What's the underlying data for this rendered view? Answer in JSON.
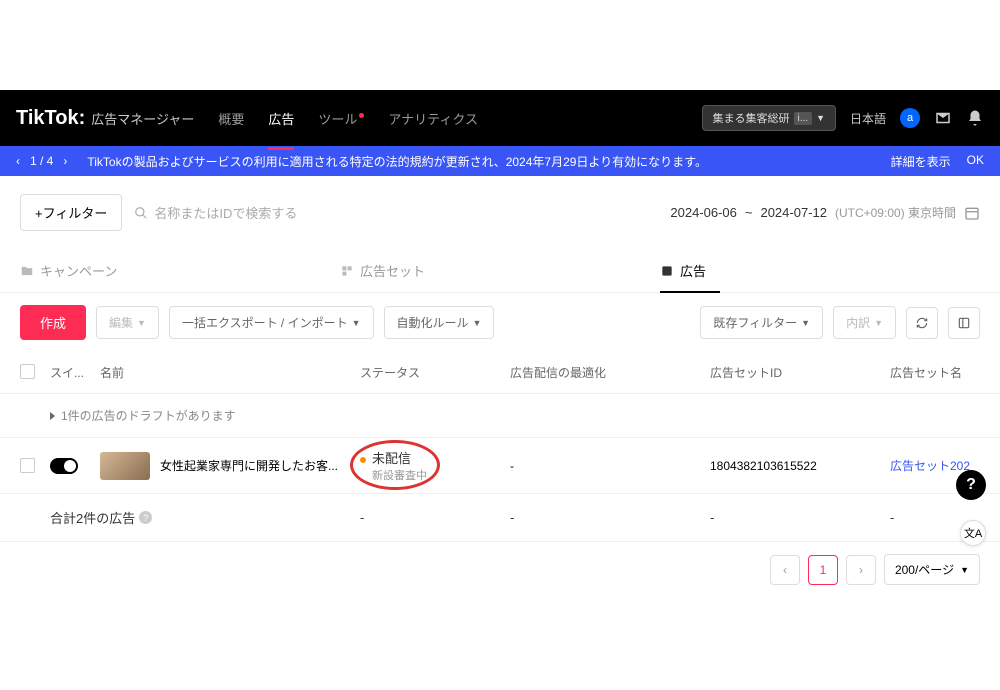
{
  "header": {
    "logo": "TikTok:",
    "logo_sub": "広告マネージャー",
    "nav": [
      "概要",
      "広告",
      "ツール",
      "アナリティクス"
    ],
    "account": "集まる集客総研",
    "account_sub": "i...",
    "language": "日本語",
    "avatar_letter": "a"
  },
  "banner": {
    "pager": "1 / 4",
    "message": "TikTokの製品およびサービスの利用に適用される特定の法的規約が更新され、2024年7月29日より有効になります。",
    "detail": "詳細を表示",
    "ok": "OK"
  },
  "toolbar": {
    "filter": "+フィルター",
    "search_placeholder": "名称またはIDで検索する",
    "date_from": "2024-06-06",
    "date_to": "2024-07-12",
    "timezone": "(UTC+09:00) 東京時間"
  },
  "tabs": {
    "campaign": "キャンペーン",
    "adset": "広告セット",
    "ad": "広告"
  },
  "actions": {
    "create": "作成",
    "edit": "編集",
    "export": "一括エクスポート / インポート",
    "rules": "自動化ルール",
    "saved_filter": "既存フィルター",
    "breakdown": "内訳"
  },
  "columns": {
    "switch": "スイ...",
    "name": "名前",
    "status": "ステータス",
    "optimization": "広告配信の最適化",
    "adset_id": "広告セットID",
    "adset_name": "広告セット名"
  },
  "draft_row": "1件の広告のドラフトがあります",
  "row": {
    "name": "女性起業家専門に開発したお客...",
    "status": "未配信",
    "status_sub": "新設審査中",
    "opt": "-",
    "adset_id": "1804382103615522",
    "adset_name": "広告セット202"
  },
  "footer": {
    "total": "合計2件の広告",
    "dash": "-"
  },
  "pagination": {
    "page": "1",
    "per_page": "200/ページ"
  }
}
